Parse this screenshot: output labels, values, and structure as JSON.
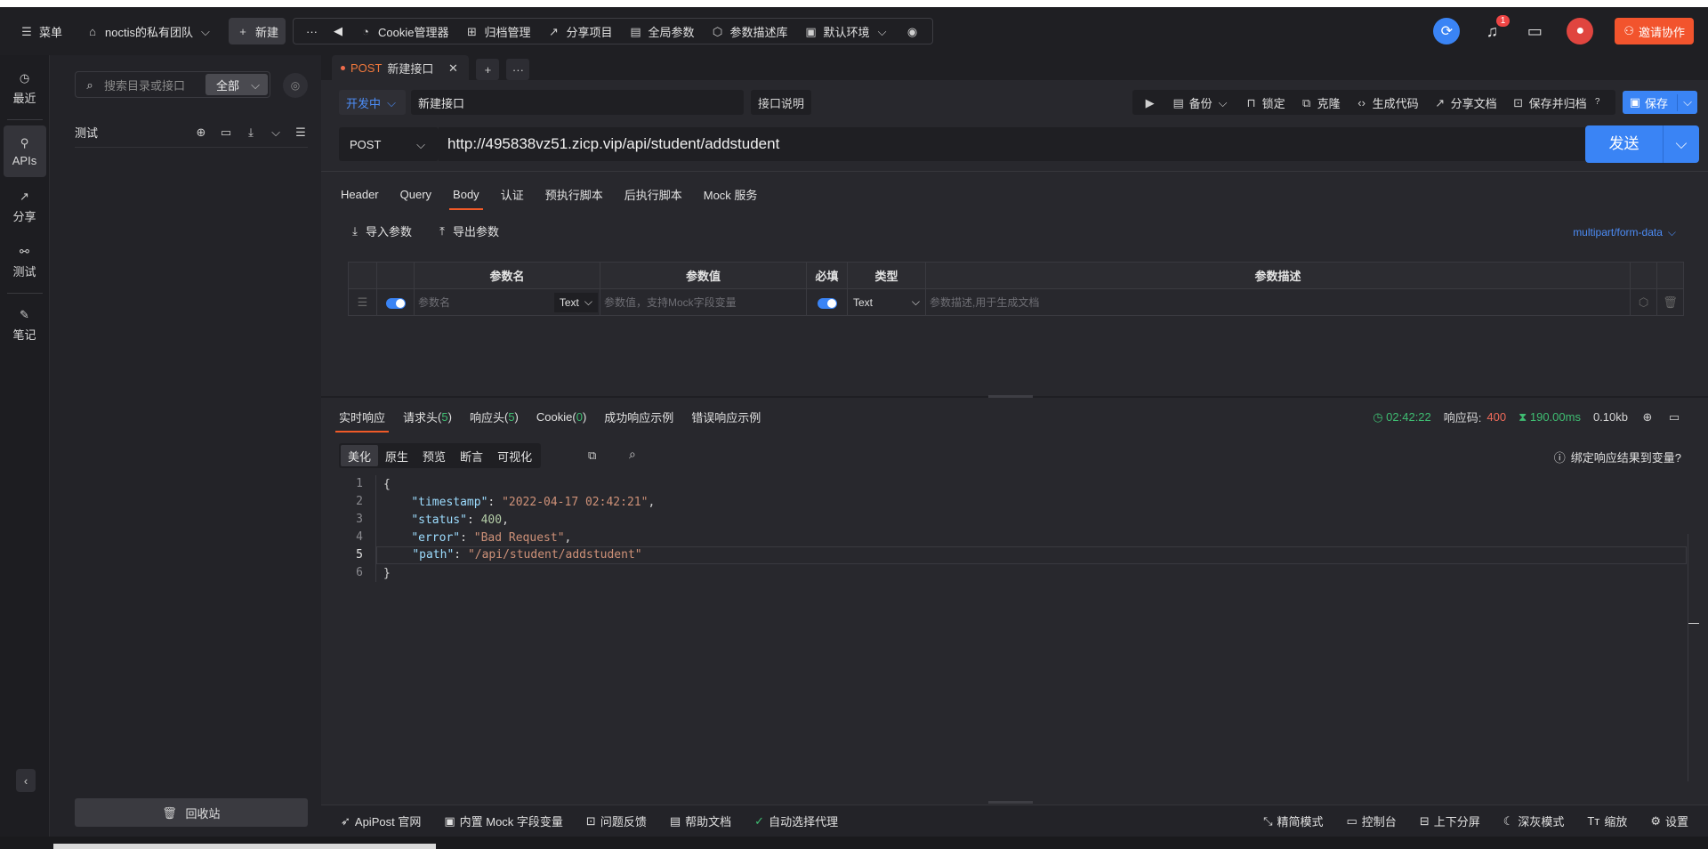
{
  "topbar": {
    "menu": "菜单",
    "team": "noctis的私有团队",
    "new_label": "新建",
    "more": "···",
    "back": "◀",
    "cookie_mgr": "Cookie管理器",
    "archive": "归档管理",
    "share_project": "分享项目",
    "global_params": "全局参数",
    "param_lib": "参数描述库",
    "env": "默认环境",
    "notification_count": "1",
    "invite": "邀请协作"
  },
  "leftnav": {
    "items": [
      {
        "label": "最近",
        "icon": "clock-icon"
      },
      {
        "label": "APIs",
        "icon": "api-icon"
      },
      {
        "label": "分享",
        "icon": "share-icon"
      },
      {
        "label": "测试",
        "icon": "test-icon"
      },
      {
        "label": "笔记",
        "icon": "note-icon"
      }
    ],
    "active_index": 1
  },
  "sidebar": {
    "search_placeholder": "搜索目录或接口",
    "filter": "全部",
    "project": "测试",
    "trash": "回收站"
  },
  "tab": {
    "method": "POST",
    "title": "新建接口"
  },
  "request": {
    "status": "开发中",
    "name": "新建接口",
    "doc_btn": "接口说明",
    "actions": {
      "backup": "备份",
      "lock": "锁定",
      "clone": "克隆",
      "gen_code": "生成代码",
      "share_doc": "分享文档",
      "save_archive": "保存并归档",
      "save": "保存"
    },
    "method": "POST",
    "url": "http://495838vz51.zicp.vip/api/student/addstudent",
    "send": "发送",
    "tabs": [
      "Header",
      "Query",
      "Body",
      "认证",
      "预执行脚本",
      "后执行脚本",
      "Mock 服务"
    ],
    "active_tab": "Body",
    "import_params": "导入参数",
    "export_params": "导出参数",
    "content_type": "multipart/form-data",
    "columns": [
      "参数名",
      "参数值",
      "必填",
      "类型",
      "参数描述"
    ],
    "row": {
      "name_placeholder": "参数名",
      "name_type": "Text",
      "value_placeholder": "参数值，支持Mock字段变量",
      "type": "Text",
      "desc_placeholder": "参数描述,用于生成文档"
    }
  },
  "response": {
    "tabs": [
      {
        "label": "实时响应",
        "count": ""
      },
      {
        "label": "请求头",
        "count": "5"
      },
      {
        "label": "响应头",
        "count": "5"
      },
      {
        "label": "Cookie",
        "count": "0"
      },
      {
        "label": "成功响应示例",
        "count": ""
      },
      {
        "label": "错误响应示例",
        "count": ""
      }
    ],
    "time": "02:42:22",
    "code_label": "响应码:",
    "code": "400",
    "duration": "190.00ms",
    "size": "0.10kb",
    "views": [
      "美化",
      "原生",
      "预览",
      "断言",
      "可视化"
    ],
    "active_view": "美化",
    "bind_var": "绑定响应结果到变量?",
    "body": {
      "timestamp": "2022-04-17 02:42:21",
      "status": "400",
      "error": "Bad Request",
      "path": "/api/student/addstudent"
    }
  },
  "footer": {
    "left": [
      "ApiPost 官网",
      "内置 Mock 字段变量",
      "问题反馈",
      "帮助文档",
      "自动选择代理"
    ],
    "right": [
      "精简模式",
      "控制台",
      "上下分屏",
      "深灰模式",
      "缩放",
      "设置"
    ]
  },
  "colors": {
    "accent": "#3a84f5",
    "orange": "#f05a28",
    "success": "#3fbd72",
    "error": "#ef6a5a"
  }
}
